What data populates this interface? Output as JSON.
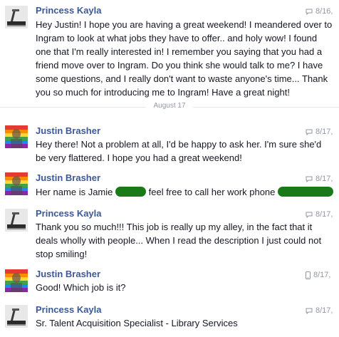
{
  "thread": {
    "date_divider": "August 17",
    "messages": [
      {
        "sender": "Princess Kayla",
        "meta": "8/16,",
        "meta_icon": "chat-bubble-icon",
        "avatar": "treadmill-avatar",
        "lines": [
          "Hey Justin! I hope you are having a great weekend! I meandered over to",
          "Ingram to look at what jobs they have to offer.. and holy wow! I found",
          "one that I'm really interested in! I remember you saying that you had a",
          "friend move over to Ingram. Do you think she would talk to me? I have",
          "some questions, and I really don't want to waste anyone's time... Thank",
          "you so much for introducing me to Ingram! Have a great night!"
        ]
      },
      {
        "sender": "Justin Brasher",
        "meta": "8/17,",
        "meta_icon": "chat-bubble-icon",
        "avatar": "rainbow-avatar",
        "lines": [
          "Hey there! Not a problem at all, I'd be happy to ask her. I'm sure she'd",
          "be very flattered. I hope you had a great weekend!"
        ]
      },
      {
        "sender": "Justin Brasher",
        "meta": "8/17,",
        "meta_icon": "chat-bubble-icon",
        "avatar": "rainbow-avatar",
        "line_a": "Her name is Jamie",
        "line_b": "feel free to call her work phone"
      },
      {
        "sender": "Princess Kayla",
        "meta": "8/17,",
        "meta_icon": "chat-bubble-icon",
        "avatar": "treadmill-avatar",
        "lines": [
          "Thank you so much!!! This job is really up my alley, in the fact that it",
          "deals wholly with people... When I read the description I just could not",
          "stop smiling!"
        ]
      },
      {
        "sender": "Justin Brasher",
        "meta": "8/17,",
        "meta_icon": "mobile-phone-icon",
        "avatar": "rainbow-avatar",
        "lines": [
          "Good! Which job is it?"
        ]
      },
      {
        "sender": "Princess Kayla",
        "meta": "8/17,",
        "meta_icon": "chat-bubble-icon",
        "avatar": "treadmill-avatar",
        "lines": [
          "Sr. Talent Acquisition Specialist - Library Services"
        ]
      }
    ]
  },
  "colors": {
    "sender_link": "#3b5998",
    "body_text": "#141823",
    "meta_text": "#9197a3",
    "divider_line": "#e5e6e9",
    "redaction": "#1a7a1a"
  }
}
